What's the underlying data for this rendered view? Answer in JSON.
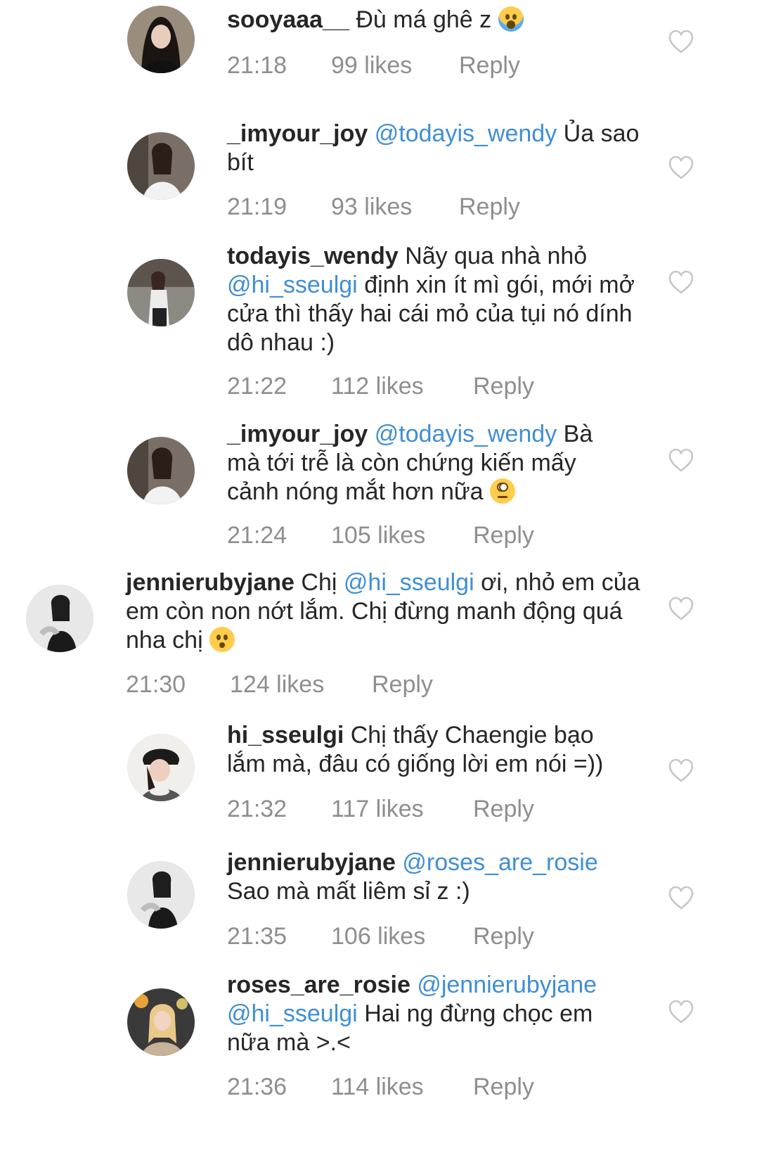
{
  "comments": [
    {
      "username": "sooyaaa__",
      "mention": "",
      "text": "Đù má ghê z",
      "emoji": "scream",
      "time": "21:18",
      "likes": "99 likes",
      "reply": "Reply"
    },
    {
      "username": "_imyour_joy",
      "mention": "@todayis_wendy",
      "text": "Ủa sao bít",
      "emoji": "",
      "time": "21:19",
      "likes": "93 likes",
      "reply": "Reply"
    },
    {
      "username": "todayis_wendy",
      "mention": "",
      "text": "Nãy qua nhà nhỏ",
      "mention2": "@hi_sseulgi",
      "text2": "định xin ít mì gói, mới mở cửa thì thấy hai cái mỏ của tụi nó dính dô nhau :)",
      "emoji": "",
      "time": "21:22",
      "likes": "112 likes",
      "reply": "Reply"
    },
    {
      "username": "_imyour_joy",
      "mention": "@todayis_wendy",
      "text": "Bà mà tới trễ là còn chứng kiến mấy cảnh nóng mắt hơn nữa",
      "emoji": "roll",
      "time": "21:24",
      "likes": "105 likes",
      "reply": "Reply"
    },
    {
      "username": "jennierubyjane",
      "mention": "",
      "text": "Chị",
      "mention2": "@hi_sseulgi",
      "text2": "ơi, nhỏ em của em còn non nớt lắm. Chị đừng manh động quá nha chị",
      "emoji": "kiss",
      "time": "21:30",
      "likes": "124 likes",
      "reply": "Reply"
    },
    {
      "username": "hi_sseulgi",
      "mention": "",
      "text": "Chị thấy Chaengie bạo lắm mà, đâu có giống lời em nói =))",
      "emoji": "",
      "time": "21:32",
      "likes": "117 likes",
      "reply": "Reply"
    },
    {
      "username": "jennierubyjane",
      "mention": "@roses_are_rosie",
      "text": "Sao mà mất liêm sỉ z :)",
      "emoji": "",
      "time": "21:35",
      "likes": "106 likes",
      "reply": "Reply"
    },
    {
      "username": "roses_are_rosie",
      "mention": "@jennierubyjane",
      "text": "",
      "mention2": "@hi_sseulgi",
      "text2": "Hai ng đừng chọc em nữa mà >.<",
      "emoji": "",
      "time": "21:36",
      "likes": "114 likes",
      "reply": "Reply"
    }
  ],
  "icons": {
    "like": "heart-outline-icon",
    "avatar": "user-avatar"
  },
  "colors": {
    "mention": "#3f8ed6",
    "meta": "#8e8e8e",
    "heart": "#c7c7c7"
  }
}
